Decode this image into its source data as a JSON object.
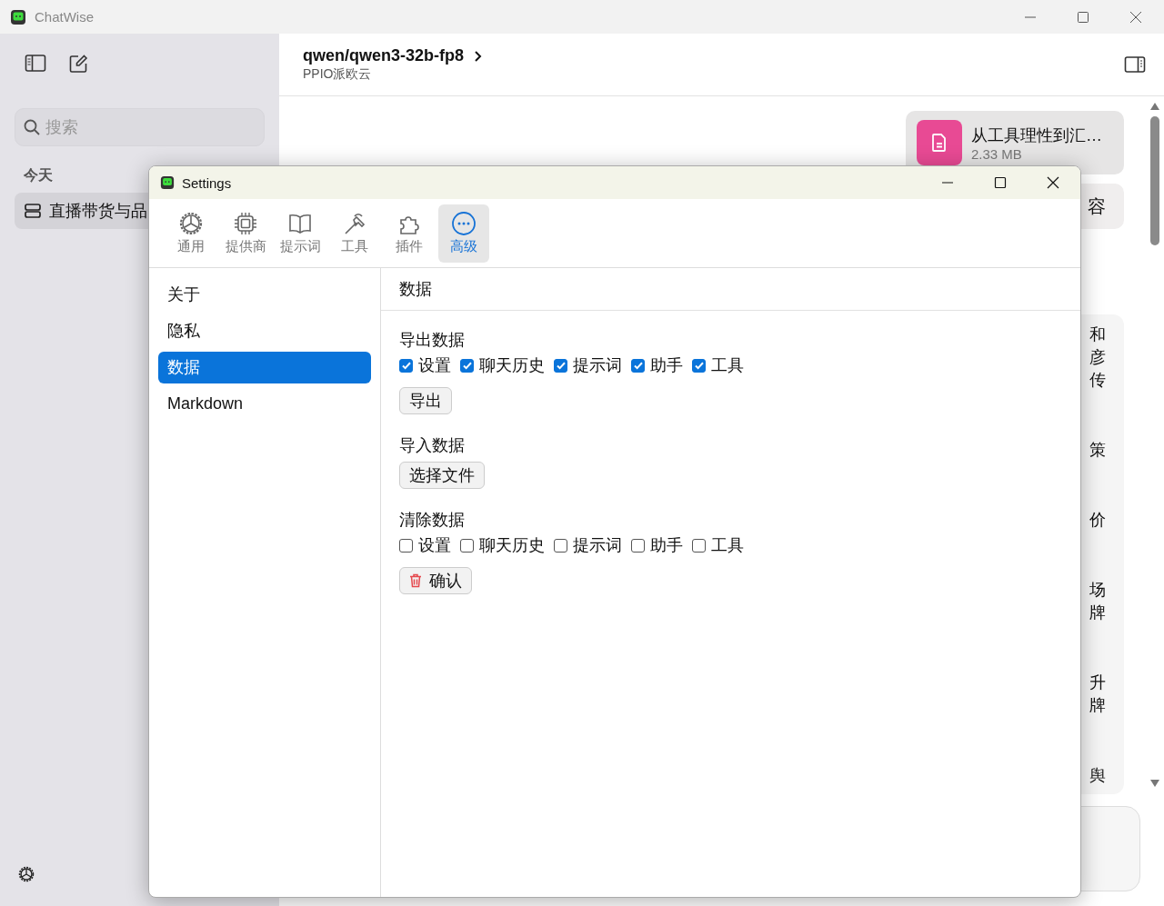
{
  "window": {
    "title": "ChatWise"
  },
  "sidebar": {
    "search": {
      "placeholder": "搜索"
    },
    "section": "今天",
    "items": [
      {
        "label": "直播带货与品",
        "selected": true
      }
    ]
  },
  "header": {
    "model": "qwen/qwen3-32b-fp8",
    "provider": "PPIO派欧云"
  },
  "messages": [
    {
      "kind": "file",
      "name": "从工具理性到汇…",
      "size": "2.33 MB"
    },
    {
      "kind": "bubble",
      "text": "容"
    },
    {
      "kind": "lines",
      "groups": [
        [
          "和",
          "彦",
          "传"
        ],
        [
          "策"
        ],
        [
          "价"
        ],
        [
          "场",
          "牌"
        ],
        [
          "升",
          "牌"
        ],
        [
          "舆"
        ]
      ]
    }
  ],
  "settings": {
    "title": "Settings",
    "tabs": [
      {
        "label": "通用",
        "selected": false
      },
      {
        "label": "提供商",
        "selected": false
      },
      {
        "label": "提示词",
        "selected": false
      },
      {
        "label": "工具",
        "selected": false
      },
      {
        "label": "插件",
        "selected": false
      },
      {
        "label": "高级",
        "selected": true
      }
    ],
    "nav": [
      {
        "label": "关于",
        "selected": false
      },
      {
        "label": "隐私",
        "selected": false
      },
      {
        "label": "数据",
        "selected": true
      },
      {
        "label": "Markdown",
        "selected": false
      }
    ],
    "section_title": "数据",
    "groups": [
      {
        "title": "导出数据",
        "options": [
          {
            "label": "设置",
            "checked": true
          },
          {
            "label": "聊天历史",
            "checked": true
          },
          {
            "label": "提示词",
            "checked": true
          },
          {
            "label": "助手",
            "checked": true
          },
          {
            "label": "工具",
            "checked": true
          }
        ],
        "button": {
          "label": "导出",
          "kind": "plain"
        }
      },
      {
        "title": "导入数据",
        "button": {
          "label": "选择文件",
          "kind": "plain"
        }
      },
      {
        "title": "清除数据",
        "options": [
          {
            "label": "设置",
            "checked": false
          },
          {
            "label": "聊天历史",
            "checked": false
          },
          {
            "label": "提示词",
            "checked": false
          },
          {
            "label": "助手",
            "checked": false
          },
          {
            "label": "工具",
            "checked": false
          }
        ],
        "button": {
          "label": "确认",
          "kind": "danger"
        }
      }
    ]
  }
}
